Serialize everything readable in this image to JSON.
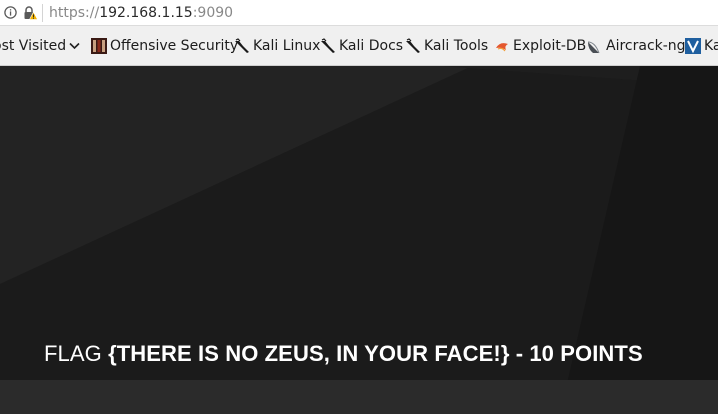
{
  "browser": {
    "url_scheme": "https://",
    "url_host": "192.168.1.15",
    "url_port": ":9090",
    "bookmarks": [
      {
        "label": "ost Visited",
        "icon": "chevron-down-icon"
      },
      {
        "label": "Offensive Security",
        "icon": "offensive-security-icon"
      },
      {
        "label": "Kali Linux",
        "icon": "kali-dragon-icon"
      },
      {
        "label": "Kali Docs",
        "icon": "kali-dragon-icon"
      },
      {
        "label": "Kali Tools",
        "icon": "kali-dragon-icon"
      },
      {
        "label": "Exploit-DB",
        "icon": "exploit-db-icon"
      },
      {
        "label": "Aircrack-ng",
        "icon": "aircrack-icon"
      },
      {
        "label": "Ka",
        "icon": "kali-blue-icon"
      }
    ]
  },
  "page": {
    "flag_prefix": "FLAG",
    "flag_body": "{THERE IS NO ZEUS, IN YOUR FACE!} - 10 POINTS"
  },
  "colors": {
    "page_background": "#1b1b1b",
    "bottom_strip": "#2b2b2b",
    "flag_text": "#ffffff"
  }
}
